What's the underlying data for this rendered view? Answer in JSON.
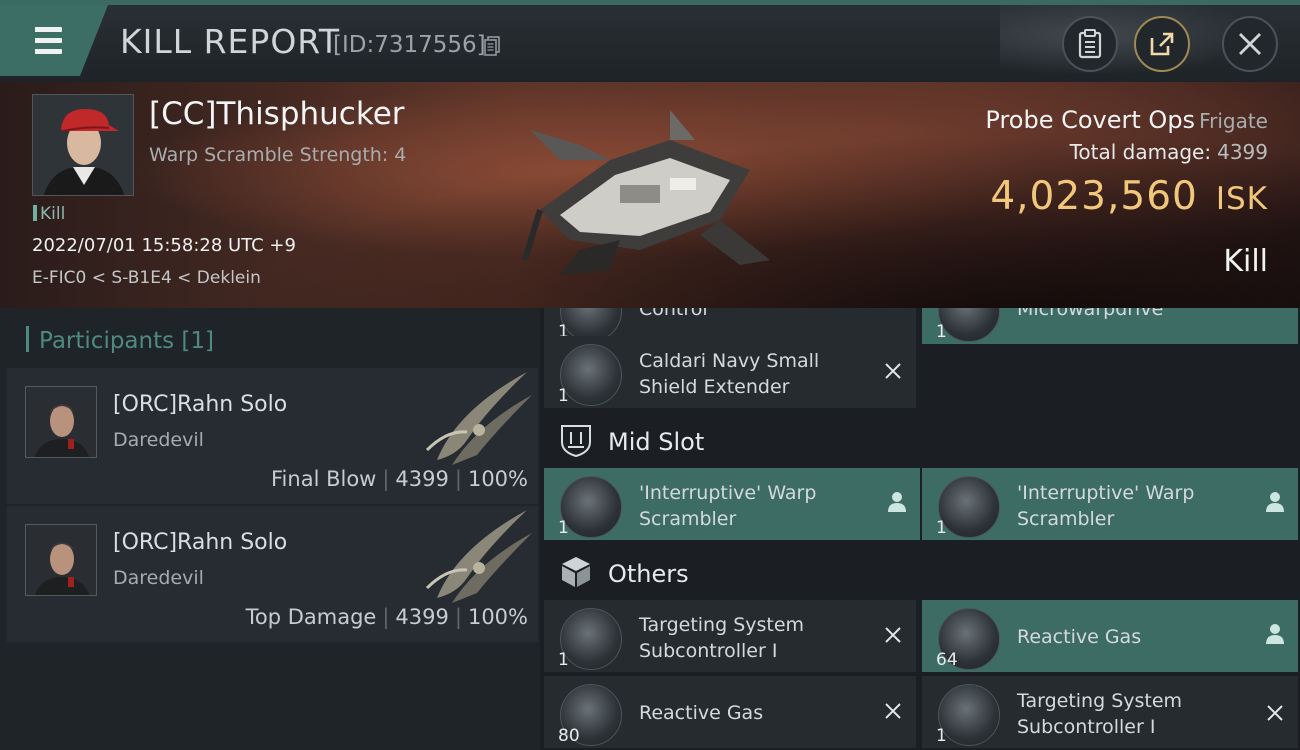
{
  "header": {
    "title": "KILL REPORT",
    "report_id": "[ID:7317556]"
  },
  "victim": {
    "name": "[CC]Thisphucker",
    "scramble": "Warp Scramble Strength: 4",
    "tag": "Kill",
    "datetime": "2022/07/01 15:58:28 UTC +9",
    "location": "E-FIC0 < S-B1E4 < Deklein",
    "ship_name": "Probe Covert Ops",
    "ship_class": "Frigate",
    "total_damage_label": "Total damage:",
    "total_damage": "4399",
    "isk_value": "4,023,560",
    "isk_unit": "ISK",
    "result": "Kill"
  },
  "participants": {
    "label": "Participants [1]",
    "items": [
      {
        "name": "[ORC]Rahn Solo",
        "ship": "Daredevil",
        "role": "Final Blow",
        "damage": "4399",
        "percent": "100%"
      },
      {
        "name": "[ORC]Rahn Solo",
        "ship": "Daredevil",
        "role": "Top Damage",
        "damage": "4399",
        "percent": "100%"
      }
    ]
  },
  "fitting": {
    "partial_top_left": {
      "name": "Control",
      "qty": "1"
    },
    "partial_top_right": {
      "name": "Microwarpdrive",
      "qty": "1"
    },
    "low_item": {
      "name": "Caldari Navy Small Shield Extender",
      "qty": "1"
    },
    "mid_slot_label": "Mid Slot",
    "mid_items": [
      {
        "name": "'Interruptive' Warp Scrambler",
        "qty": "1"
      },
      {
        "name": "'Interruptive' Warp Scrambler",
        "qty": "1"
      }
    ],
    "others_label": "Others",
    "others_items": [
      {
        "name": "Targeting System Subcontroller I",
        "qty": "1"
      },
      {
        "name": "Reactive Gas",
        "qty": "64"
      },
      {
        "name": "Reactive Gas",
        "qty": "80"
      },
      {
        "name": "Targeting System Subcontroller I",
        "qty": "1"
      }
    ]
  },
  "colors": {
    "accent_teal": "#3c6c64",
    "isk_gold": "#f1c77c",
    "panel": "#262b30"
  },
  "icons": [
    "menu-icon",
    "copy-icon",
    "clipboard-icon",
    "share-icon",
    "close-icon",
    "mid-slot-icon",
    "others-cube-icon",
    "remove-x-icon",
    "pilot-icon"
  ]
}
